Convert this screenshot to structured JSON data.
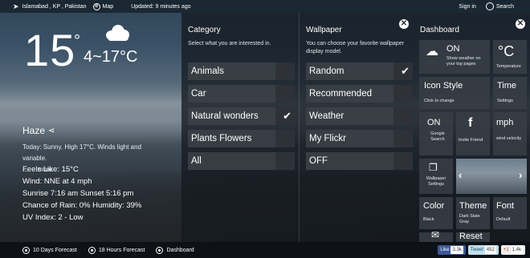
{
  "topbar": {
    "location": "Islamabad , KP , Pakistan",
    "map_label": "Map",
    "updated": "Updated: 9 minutes ago",
    "signin_label": "Sign in",
    "search_label": "Search"
  },
  "weather": {
    "temperature": "15",
    "degree_symbol": "°",
    "range": "4~17°C",
    "condition": "Haze",
    "description": "Today: Sunny. High 17°C. Winds light and variable.",
    "ellipsis": "...",
    "more_label": "more",
    "feels_like": "Feels Like: 15°C",
    "wind": "Wind: NNE at 4 mph",
    "sun": "Sunrise 7:16 am Sunset 5:16 pm",
    "rain_humidity": "Chance of Rain: 0% Humidity: 39%",
    "uv": "UV Index: 2 - Low"
  },
  "category": {
    "title": "Category",
    "subtitle": "Select what you are interested in.",
    "items": [
      {
        "label": "Animals",
        "checked": false
      },
      {
        "label": "Car",
        "checked": false
      },
      {
        "label": "Natural wonders",
        "checked": true
      },
      {
        "label": "Plants Flowers",
        "checked": false
      },
      {
        "label": "All",
        "checked": false
      }
    ]
  },
  "wallpaper": {
    "title": "Wallpaper",
    "subtitle": "You can choose your favorite wallpaper display model.",
    "items": [
      {
        "label": "Random",
        "checked": true
      },
      {
        "label": "Recommended",
        "checked": false
      },
      {
        "label": "Weather",
        "checked": false
      },
      {
        "label": "My Flickr",
        "checked": false
      },
      {
        "label": "OFF",
        "checked": false
      }
    ]
  },
  "dashboard": {
    "title": "Dashboard",
    "tiles": {
      "weather_on": {
        "big": "ON",
        "small": "Show weather on your top pages"
      },
      "temperature": {
        "big": "°C",
        "small": "Temperature"
      },
      "icon_style": {
        "big": "Icon Style",
        "small": "Click to change"
      },
      "time": {
        "big": "Time",
        "small": "Settings"
      },
      "google": {
        "big": "ON",
        "small": "Google Search"
      },
      "invite": {
        "big": "f",
        "small": "Invite Friend"
      },
      "wind": {
        "big": "mph",
        "small": "wind velocity"
      },
      "wallpaper_settings": {
        "small": "Wallpaper Settings"
      },
      "color": {
        "big": "Color",
        "small": "Black"
      },
      "theme": {
        "big": "Theme",
        "small": "Dark Slate Gray"
      },
      "font": {
        "big": "Font",
        "small": "Default"
      },
      "reset": {
        "big": "Reset"
      }
    },
    "nav_prev": "‹",
    "nav_next": "›"
  },
  "bottombar": {
    "forecast10": "10 Days Forecast",
    "forecast18": "18 Hours Forecast",
    "dashboard": "Dashboard",
    "like_label": "Like",
    "like_count": "3.3k",
    "tweet_label": "Tweet",
    "tweet_count": "452",
    "gplus_label": "+1",
    "gplus_count": "1.4k"
  },
  "colors": {
    "panel_bg": "#1a2026",
    "tile_bg": "#373e46",
    "facebook": "#3b5998",
    "twitter": "#c0dfec",
    "gplus": "#eeeeee"
  }
}
